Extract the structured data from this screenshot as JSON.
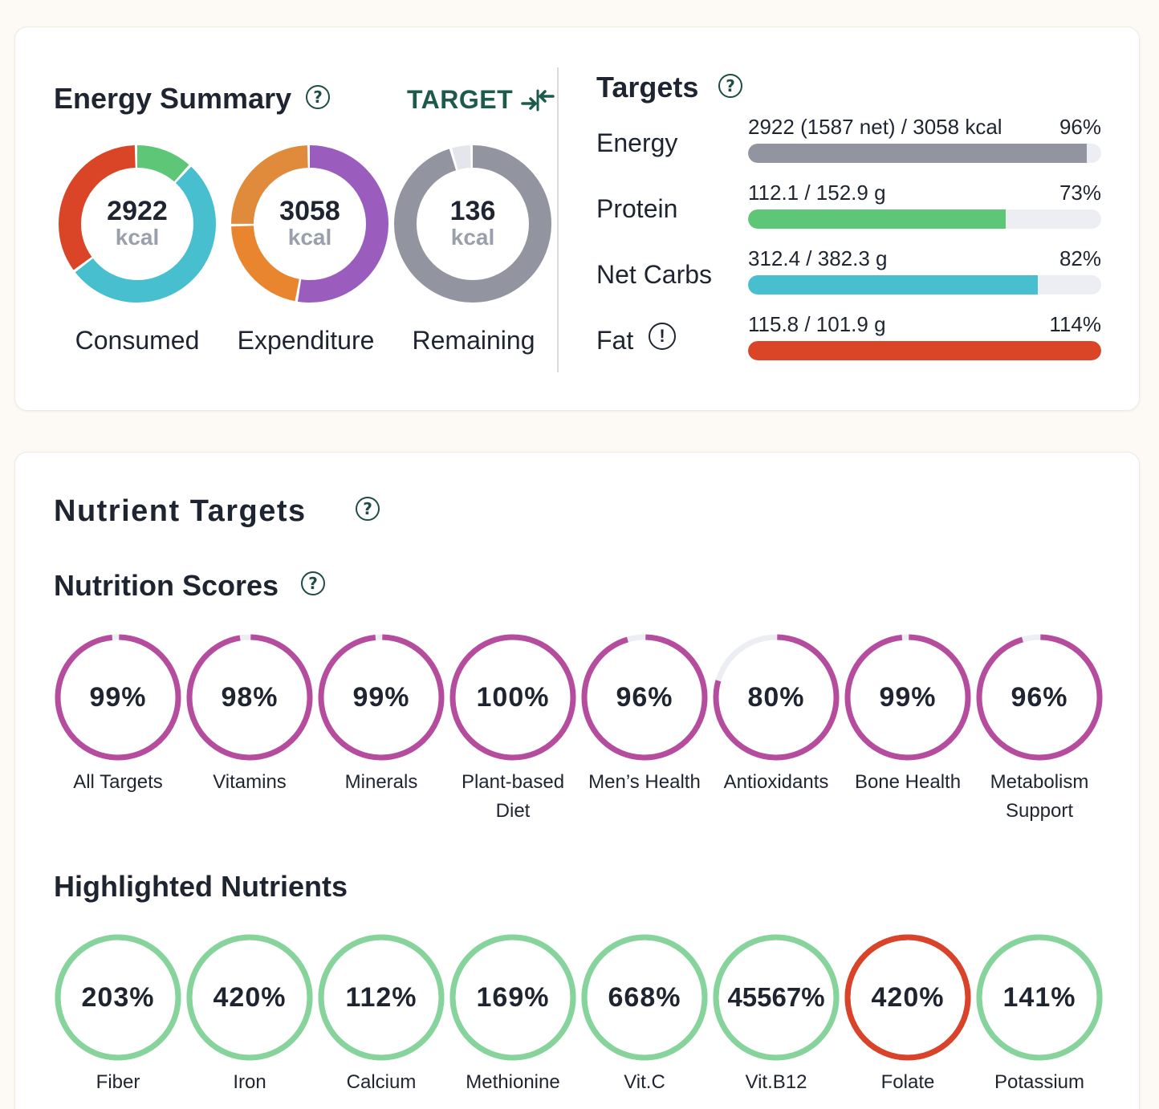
{
  "energy_summary": {
    "title": "Energy Summary",
    "target_button": "TARGET",
    "donuts": [
      {
        "value": "2922",
        "unit": "kcal",
        "label": "Consumed",
        "segments": [
          {
            "color": "#5ec677",
            "fraction": 0.12
          },
          {
            "color": "#47bfcf",
            "fraction": 0.53
          },
          {
            "color": "#db4527",
            "fraction": 0.35
          }
        ]
      },
      {
        "value": "3058",
        "unit": "kcal",
        "label": "Expenditure",
        "segments": [
          {
            "color": "#9b5dbd",
            "fraction": 0.53
          },
          {
            "color": "#e9852f",
            "fraction": 0.22
          },
          {
            "color": "#e08a3c",
            "fraction": 0.25
          }
        ]
      },
      {
        "value": "136",
        "unit": "kcal",
        "label": "Remaining",
        "segments": [
          {
            "color": "#92959f",
            "fraction": 0.957
          },
          {
            "color": "#e4e6ec",
            "fraction": 0.043
          }
        ]
      }
    ]
  },
  "targets": {
    "title": "Targets",
    "rows": [
      {
        "label": "Energy",
        "amount": "2922 (1587 net) / 3058 kcal",
        "percent_text": "96%",
        "fill": 0.96,
        "color": "#92959f"
      },
      {
        "label": "Protein",
        "amount": "112.1 / 152.9 g",
        "percent_text": "73%",
        "fill": 0.73,
        "color": "#5ec677"
      },
      {
        "label": "Net Carbs",
        "amount": "312.4 / 382.3 g",
        "percent_text": "82%",
        "fill": 0.82,
        "color": "#47bfcf"
      },
      {
        "label": "Fat",
        "amount": "115.8 / 101.9 g",
        "percent_text": "114%",
        "fill": 1.0,
        "color": "#db4527",
        "warning": "!"
      }
    ]
  },
  "nutrient_targets": {
    "title": "Nutrient Targets",
    "scores_title": "Nutrition Scores",
    "score_color": "#b54c9e",
    "track_color": "#eceef3",
    "scores": [
      {
        "value": "99%",
        "fraction": 0.99,
        "label": "All Targets"
      },
      {
        "value": "98%",
        "fraction": 0.98,
        "label": "Vitamins"
      },
      {
        "value": "99%",
        "fraction": 0.99,
        "label": "Minerals"
      },
      {
        "value": "100%",
        "fraction": 1.0,
        "label": "Plant-based Diet"
      },
      {
        "value": "96%",
        "fraction": 0.96,
        "label": "Men’s Health"
      },
      {
        "value": "80%",
        "fraction": 0.8,
        "label": "Antioxidants"
      },
      {
        "value": "99%",
        "fraction": 0.99,
        "label": "Bone Health"
      },
      {
        "value": "96%",
        "fraction": 0.96,
        "label": "Metabolism Support"
      }
    ],
    "highlighted_title": "Highlighted Nutrients",
    "highlighted": [
      {
        "value": "203%",
        "label": "Fiber",
        "color": "#86d49b"
      },
      {
        "value": "420%",
        "label": "Iron",
        "color": "#86d49b"
      },
      {
        "value": "112%",
        "label": "Calcium",
        "color": "#86d49b"
      },
      {
        "value": "169%",
        "label": "Methionine",
        "color": "#86d49b"
      },
      {
        "value": "668%",
        "label": "Vit.C",
        "color": "#86d49b"
      },
      {
        "value": "45567%",
        "label": "Vit.B12",
        "color": "#86d49b"
      },
      {
        "value": "420%",
        "label": "Folate",
        "color": "#d8432a"
      },
      {
        "value": "141%",
        "label": "Potassium",
        "color": "#86d49b"
      }
    ]
  }
}
